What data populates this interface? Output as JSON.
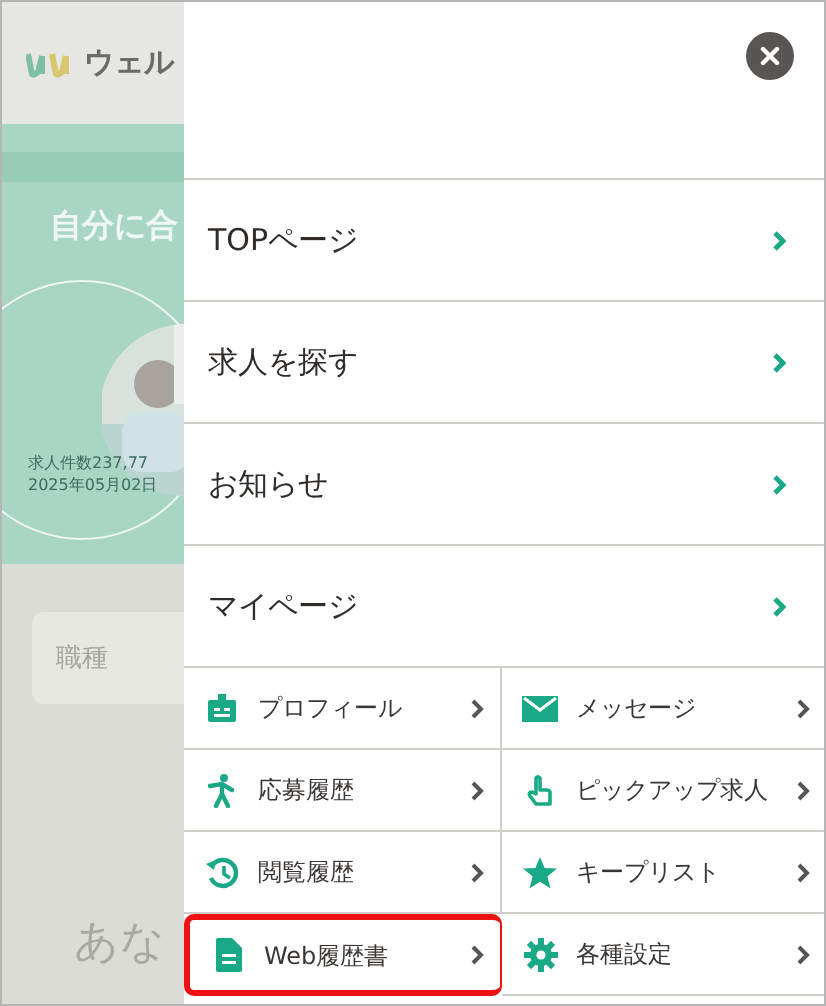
{
  "background_page": {
    "logo_text": "ウェル",
    "banner_heading": "自分に合",
    "stats_lines": [
      "求人件数237,77",
      "2025年05月02日"
    ],
    "search_field": {
      "placeholder": "職種"
    },
    "footer_text": "あな"
  },
  "menu": {
    "main_items": [
      {
        "label": "TOPページ"
      },
      {
        "label": "求人を探す"
      },
      {
        "label": "お知らせ"
      },
      {
        "label": "マイページ"
      }
    ],
    "sub_items": [
      {
        "label": "プロフィール",
        "highlighted": false
      },
      {
        "label": "メッセージ",
        "highlighted": false
      },
      {
        "label": "応募履歴",
        "highlighted": false
      },
      {
        "label": "ピックアップ求人",
        "highlighted": false
      },
      {
        "label": "閲覧履歴",
        "highlighted": false
      },
      {
        "label": "キープリスト",
        "highlighted": false
      },
      {
        "label": "Web履歴書",
        "highlighted": true
      },
      {
        "label": "各種設定",
        "highlighted": false
      }
    ]
  }
}
